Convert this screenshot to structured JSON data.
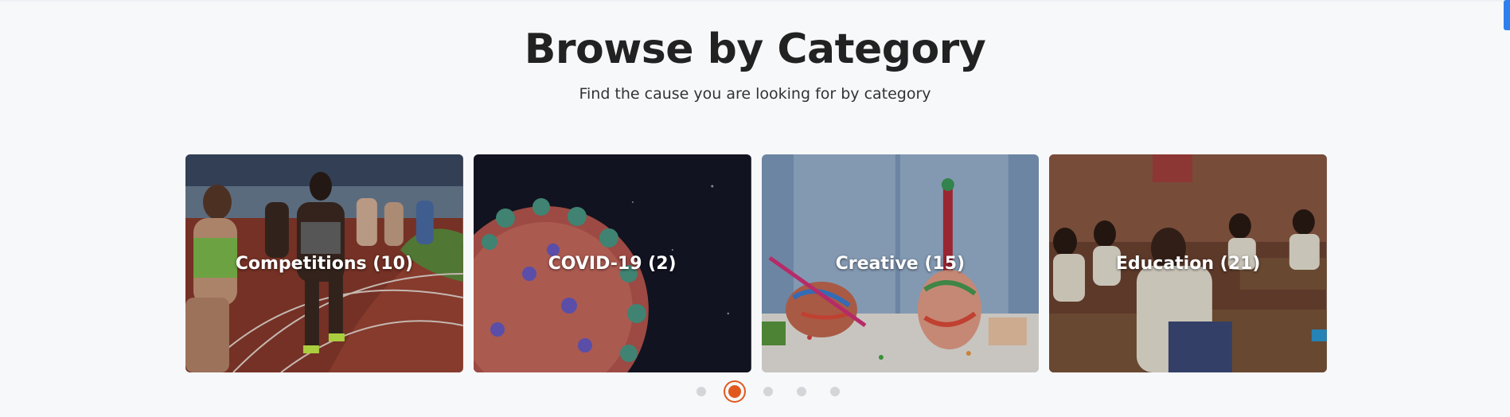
{
  "section": {
    "title": "Browse by Category",
    "subtitle": "Find the cause you are looking for by category"
  },
  "categories": [
    {
      "label": "Competitions (10)",
      "image": "running-track-athletes"
    },
    {
      "label": "COVID-19 (2)",
      "image": "virus-particle"
    },
    {
      "label": "Creative (15)",
      "image": "painted-hands"
    },
    {
      "label": "Education (21)",
      "image": "classroom-students"
    }
  ],
  "carousel": {
    "page_count": 5,
    "active_page": 2,
    "active_color": "#e0581e"
  }
}
